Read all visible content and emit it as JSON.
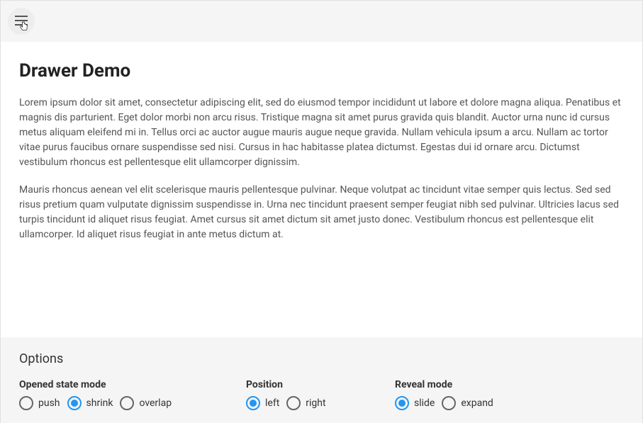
{
  "header": {
    "title": "Drawer Demo"
  },
  "content": {
    "paragraphs": [
      "Lorem ipsum dolor sit amet, consectetur adipiscing elit, sed do eiusmod tempor incididunt ut labore et dolore magna aliqua. Penatibus et magnis dis parturient. Eget dolor morbi non arcu risus. Tristique magna sit amet purus gravida quis blandit. Auctor urna nunc id cursus metus aliquam eleifend mi in. Tellus orci ac auctor augue mauris augue neque gravida. Nullam vehicula ipsum a arcu. Nullam ac tortor vitae purus faucibus ornare suspendisse sed nisi. Cursus in hac habitasse platea dictumst. Egestas dui id ornare arcu. Dictumst vestibulum rhoncus est pellentesque elit ullamcorper dignissim.",
      "Mauris rhoncus aenean vel elit scelerisque mauris pellentesque pulvinar. Neque volutpat ac tincidunt vitae semper quis lectus. Sed sed risus pretium quam vulputate dignissim suspendisse in. Urna nec tincidunt praesent semper feugiat nibh sed pulvinar. Ultricies lacus sed turpis tincidunt id aliquet risus feugiat. Amet cursus sit amet dictum sit amet justo donec. Vestibulum rhoncus est pellentesque elit ullamcorper. Id aliquet risus feugiat in ante metus dictum at."
    ]
  },
  "options": {
    "title": "Options",
    "groups": [
      {
        "label": "Opened state mode",
        "items": [
          {
            "label": "push",
            "selected": false
          },
          {
            "label": "shrink",
            "selected": true
          },
          {
            "label": "overlap",
            "selected": false
          }
        ]
      },
      {
        "label": "Position",
        "items": [
          {
            "label": "left",
            "selected": true
          },
          {
            "label": "right",
            "selected": false
          }
        ]
      },
      {
        "label": "Reveal mode",
        "items": [
          {
            "label": "slide",
            "selected": true
          },
          {
            "label": "expand",
            "selected": false
          }
        ]
      }
    ]
  },
  "colors": {
    "accent": "#2196f3",
    "panel_bg": "#f5f5f5"
  }
}
